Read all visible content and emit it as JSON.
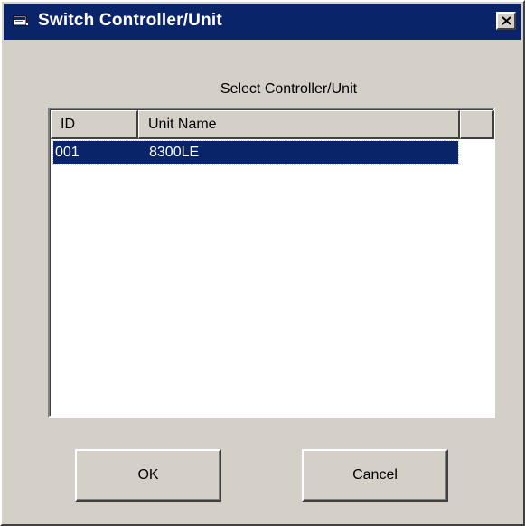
{
  "window": {
    "title": "Switch Controller/Unit",
    "title_icon": "app-window-icon",
    "close_icon": "close-icon"
  },
  "prompt": "Select Controller/Unit",
  "listview": {
    "columns": [
      "ID",
      "Unit Name",
      ""
    ],
    "rows": [
      {
        "id": "001",
        "unit_name": "8300LE",
        "selected": true
      }
    ]
  },
  "buttons": {
    "ok": "OK",
    "cancel": "Cancel"
  },
  "colors": {
    "face": "#d4d0c8",
    "titlebar": "#0a246a",
    "selection": "#0a246a"
  }
}
